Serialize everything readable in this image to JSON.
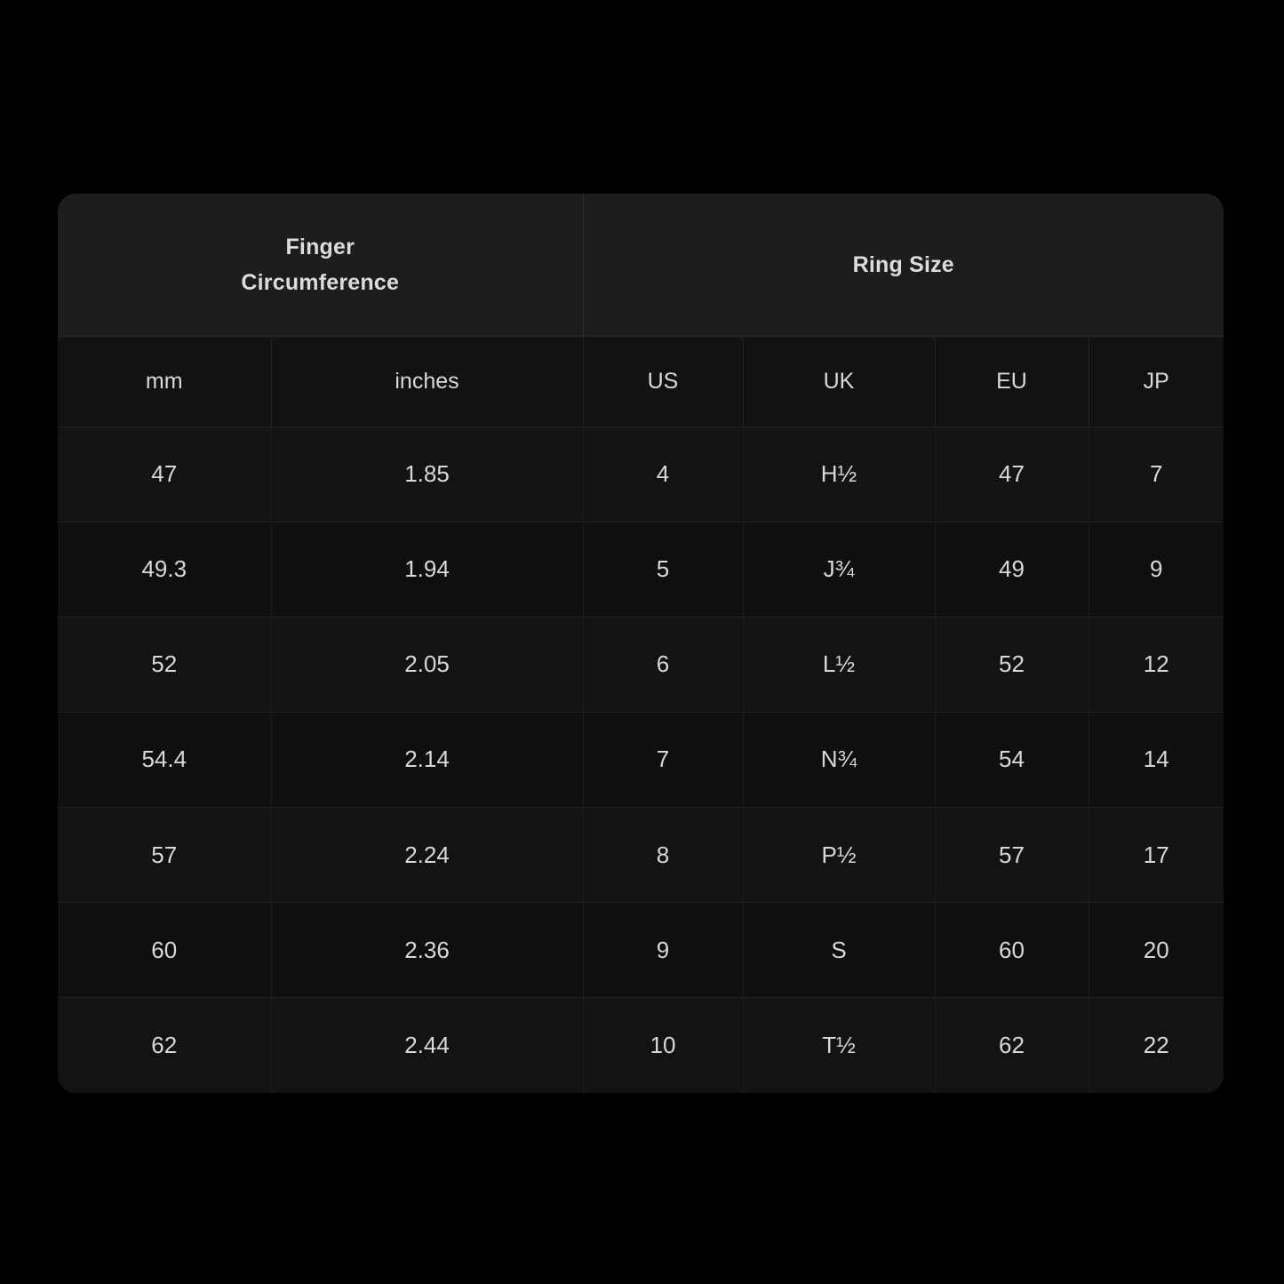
{
  "table": {
    "group_headers": [
      {
        "id": "finger-circumference",
        "lines": [
          "Finger",
          "Circumference"
        ],
        "colspan": 2
      },
      {
        "id": "ring-size",
        "lines": [
          "Ring Size"
        ],
        "colspan": 4
      }
    ],
    "columns": [
      {
        "key": "mm",
        "label": "mm"
      },
      {
        "key": "inches",
        "label": "inches"
      },
      {
        "key": "us",
        "label": "US"
      },
      {
        "key": "uk",
        "label": "UK"
      },
      {
        "key": "eu",
        "label": "EU"
      },
      {
        "key": "jp",
        "label": "JP"
      }
    ],
    "rows": [
      {
        "mm": "47",
        "inches": "1.85",
        "us": "4",
        "uk": "H½",
        "eu": "47",
        "jp": "7"
      },
      {
        "mm": "49.3",
        "inches": "1.94",
        "us": "5",
        "uk": "J¾",
        "eu": "49",
        "jp": "9"
      },
      {
        "mm": "52",
        "inches": "2.05",
        "us": "6",
        "uk": "L½",
        "eu": "52",
        "jp": "12"
      },
      {
        "mm": "54.4",
        "inches": "2.14",
        "us": "7",
        "uk": "N¾",
        "eu": "54",
        "jp": "14"
      },
      {
        "mm": "57",
        "inches": "2.24",
        "us": "8",
        "uk": "P½",
        "eu": "57",
        "jp": "17"
      },
      {
        "mm": "60",
        "inches": "2.36",
        "us": "9",
        "uk": "S",
        "eu": "60",
        "jp": "20"
      },
      {
        "mm": "62",
        "inches": "2.44",
        "us": "10",
        "uk": "T½",
        "eu": "62",
        "jp": "22"
      }
    ]
  },
  "colors": {
    "page_background": "#000000",
    "group_header_background": "#1d1d1d",
    "sub_header_background": "#121212",
    "row_background": "#111111",
    "text": "#d8d8d8",
    "grid_line": "#242424"
  }
}
